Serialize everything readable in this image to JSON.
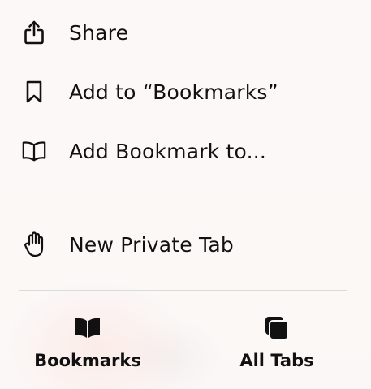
{
  "menu": {
    "items": [
      {
        "label": "Share",
        "icon": "share-icon"
      },
      {
        "label": "Add to “Bookmarks”",
        "icon": "bookmark-icon"
      },
      {
        "label": "Add Bookmark to...",
        "icon": "book-icon"
      },
      {
        "label": "New Private Tab",
        "icon": "hand-icon"
      }
    ]
  },
  "bottom_bar": {
    "bookmarks_label": "Bookmarks",
    "bookmarks_icon": "book-filled-icon",
    "all_tabs_label": "All Tabs",
    "all_tabs_icon": "tabs-icon"
  },
  "colors": {
    "text": "#111111",
    "separator": "#dcdad9",
    "backdrop_accent": "#f07864"
  }
}
